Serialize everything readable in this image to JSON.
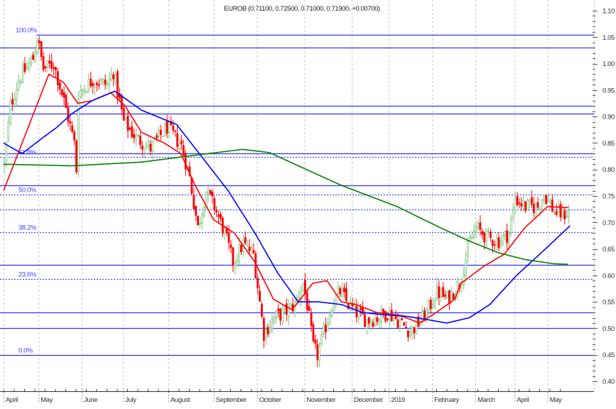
{
  "chart_data": {
    "type": "candlestick",
    "title": "EUROB (0.71100, 0.72500, 0.71000, 0.71900, +0.00700)",
    "ylim": [
      0.4,
      1.1
    ],
    "y_ticks": [
      "1.10",
      "1.05",
      "1.00",
      "0.95",
      "0.90",
      "0.85",
      "0.80",
      "0.75",
      "0.70",
      "0.65",
      "0.60",
      "0.55",
      "0.50",
      "0.45",
      "0.40"
    ],
    "x_days": 275,
    "months": [
      {
        "label": "April",
        "day": 0
      },
      {
        "label": "May",
        "day": 17
      },
      {
        "label": "June",
        "day": 38
      },
      {
        "label": "July",
        "day": 58
      },
      {
        "label": "August",
        "day": 80
      },
      {
        "label": "September",
        "day": 102
      },
      {
        "label": "October",
        "day": 123
      },
      {
        "label": "November",
        "day": 146
      },
      {
        "label": "December",
        "day": 169
      },
      {
        "label": "2019",
        "day": 187
      },
      {
        "label": "February",
        "day": 208
      },
      {
        "label": "March",
        "day": 229
      },
      {
        "label": "April",
        "day": 248
      },
      {
        "label": "May",
        "day": 264
      }
    ],
    "close_path": [
      [
        0,
        0.81
      ],
      [
        3,
        0.92
      ],
      [
        7,
        0.97
      ],
      [
        14,
        1.01
      ],
      [
        16,
        1.05
      ],
      [
        19,
        0.99
      ],
      [
        24,
        1.0
      ],
      [
        29,
        0.93
      ],
      [
        34,
        0.85
      ],
      [
        35,
        0.8
      ],
      [
        36,
        0.945
      ],
      [
        43,
        0.97
      ],
      [
        50,
        0.96
      ],
      [
        53,
        0.985
      ],
      [
        58,
        0.89
      ],
      [
        64,
        0.86
      ],
      [
        71,
        0.84
      ],
      [
        79,
        0.88
      ],
      [
        86,
        0.845
      ],
      [
        90,
        0.785
      ],
      [
        94,
        0.69
      ],
      [
        98,
        0.76
      ],
      [
        102,
        0.73
      ],
      [
        107,
        0.68
      ],
      [
        111,
        0.625
      ],
      [
        116,
        0.66
      ],
      [
        121,
        0.64
      ],
      [
        126,
        0.49
      ],
      [
        131,
        0.52
      ],
      [
        136,
        0.53
      ],
      [
        141,
        0.545
      ],
      [
        145,
        0.585
      ],
      [
        147,
        0.545
      ],
      [
        150,
        0.465
      ],
      [
        152,
        0.45
      ],
      [
        155,
        0.49
      ],
      [
        159,
        0.545
      ],
      [
        163,
        0.57
      ],
      [
        167,
        0.545
      ],
      [
        171,
        0.53
      ],
      [
        176,
        0.515
      ],
      [
        181,
        0.52
      ],
      [
        186,
        0.53
      ],
      [
        191,
        0.515
      ],
      [
        197,
        0.495
      ],
      [
        200,
        0.505
      ],
      [
        205,
        0.53
      ],
      [
        210,
        0.57
      ],
      [
        215,
        0.555
      ],
      [
        221,
        0.585
      ],
      [
        226,
        0.665
      ],
      [
        229,
        0.69
      ],
      [
        235,
        0.67
      ],
      [
        240,
        0.665
      ],
      [
        245,
        0.68
      ],
      [
        248,
        0.745
      ],
      [
        253,
        0.73
      ],
      [
        259,
        0.73
      ],
      [
        262,
        0.755
      ],
      [
        267,
        0.72
      ],
      [
        271,
        0.715
      ],
      [
        274,
        0.719
      ]
    ],
    "moving_averages": [
      {
        "name": "MA short",
        "color": "#ff0000",
        "points": [
          [
            0,
            0.76
          ],
          [
            5,
            0.81
          ],
          [
            16,
            0.92
          ],
          [
            22,
            0.98
          ],
          [
            29,
            0.965
          ],
          [
            36,
            0.925
          ],
          [
            43,
            0.93
          ],
          [
            52,
            0.945
          ],
          [
            59,
            0.92
          ],
          [
            67,
            0.87
          ],
          [
            78,
            0.85
          ],
          [
            86,
            0.83
          ],
          [
            93,
            0.77
          ],
          [
            102,
            0.705
          ],
          [
            112,
            0.68
          ],
          [
            122,
            0.625
          ],
          [
            131,
            0.555
          ],
          [
            140,
            0.535
          ],
          [
            150,
            0.585
          ],
          [
            157,
            0.59
          ],
          [
            164,
            0.55
          ],
          [
            171,
            0.545
          ],
          [
            181,
            0.53
          ],
          [
            192,
            0.525
          ],
          [
            202,
            0.51
          ],
          [
            210,
            0.53
          ],
          [
            219,
            0.555
          ],
          [
            222,
            0.585
          ],
          [
            233,
            0.617
          ],
          [
            243,
            0.64
          ],
          [
            253,
            0.69
          ],
          [
            264,
            0.73
          ],
          [
            274,
            0.728
          ]
        ]
      },
      {
        "name": "MA medium",
        "color": "#0000ff",
        "points": [
          [
            0,
            0.85
          ],
          [
            9,
            0.83
          ],
          [
            19,
            0.86
          ],
          [
            26,
            0.88
          ],
          [
            33,
            0.905
          ],
          [
            43,
            0.93
          ],
          [
            54,
            0.948
          ],
          [
            67,
            0.912
          ],
          [
            84,
            0.885
          ],
          [
            95,
            0.83
          ],
          [
            109,
            0.76
          ],
          [
            122,
            0.68
          ],
          [
            133,
            0.605
          ],
          [
            143,
            0.55
          ],
          [
            153,
            0.55
          ],
          [
            164,
            0.545
          ],
          [
            174,
            0.53
          ],
          [
            184,
            0.526
          ],
          [
            195,
            0.523
          ],
          [
            205,
            0.517
          ],
          [
            215,
            0.51
          ],
          [
            226,
            0.52
          ],
          [
            236,
            0.545
          ],
          [
            249,
            0.6
          ],
          [
            263,
            0.65
          ],
          [
            275,
            0.694
          ]
        ]
      },
      {
        "name": "MA long",
        "color": "#008000",
        "points": [
          [
            0,
            0.81
          ],
          [
            33,
            0.807
          ],
          [
            67,
            0.814
          ],
          [
            95,
            0.828
          ],
          [
            116,
            0.838
          ],
          [
            129,
            0.832
          ],
          [
            147,
            0.8
          ],
          [
            164,
            0.77
          ],
          [
            191,
            0.73
          ],
          [
            212,
            0.69
          ],
          [
            226,
            0.665
          ],
          [
            240,
            0.643
          ],
          [
            253,
            0.63
          ],
          [
            267,
            0.622
          ],
          [
            274,
            0.621
          ]
        ]
      }
    ],
    "levels": [
      {
        "price": 1.055,
        "style": "solid",
        "label": "100.0%",
        "from_day": 16
      },
      {
        "price": 1.03,
        "style": "solid"
      },
      {
        "price": 0.92,
        "style": "solid"
      },
      {
        "price": 0.905,
        "style": "solid"
      },
      {
        "price": 0.83,
        "style": "solid"
      },
      {
        "price": 0.824,
        "style": "dotted",
        "label": "61.8%"
      },
      {
        "price": 0.77,
        "style": "solid"
      },
      {
        "price": 0.7525,
        "style": "dotted",
        "label": "50.0%"
      },
      {
        "price": 0.725,
        "style": "dotted"
      },
      {
        "price": 0.681,
        "style": "dotted",
        "label": "38.2%"
      },
      {
        "price": 0.62,
        "style": "solid"
      },
      {
        "price": 0.593,
        "style": "dotted",
        "label": "23.6%"
      },
      {
        "price": 0.53,
        "style": "solid"
      },
      {
        "price": 0.5,
        "style": "solid"
      },
      {
        "price": 0.45,
        "style": "solid",
        "label": "0.0%"
      }
    ],
    "colors": {
      "up": "#7fc47f",
      "down": "#ff0000",
      "level": "#3333ff",
      "grid": "#c8c8c8"
    }
  }
}
